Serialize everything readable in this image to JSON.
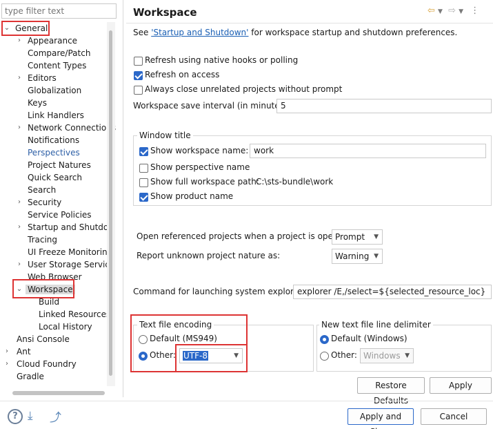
{
  "filter": {
    "placeholder": "type filter text"
  },
  "tree": {
    "general": "General",
    "appearance": "Appearance",
    "compare_patch": "Compare/Patch",
    "content_types": "Content Types",
    "editors": "Editors",
    "globalization": "Globalization",
    "keys": "Keys",
    "link_handlers": "Link Handlers",
    "network_connections": "Network Connections",
    "notifications": "Notifications",
    "perspectives": "Perspectives",
    "project_natures": "Project Natures",
    "quick_search": "Quick Search",
    "search": "Search",
    "security": "Security",
    "service_policies": "Service Policies",
    "startup_shutdown": "Startup and Shutdown",
    "tracing": "Tracing",
    "ui_freeze": "UI Freeze Monitoring",
    "user_storage": "User Storage Service",
    "web_browser": "Web Browser",
    "workspace": "Workspace",
    "build": "Build",
    "linked_resources": "Linked Resources",
    "local_history": "Local History",
    "ansi_console": "Ansi Console",
    "ant": "Ant",
    "cloud_foundry": "Cloud Foundry",
    "gradle": "Gradle"
  },
  "page": {
    "title": "Workspace",
    "see_prefix": "See ",
    "see_link": "'Startup and Shutdown'",
    "see_suffix": " for workspace startup and shutdown preferences.",
    "refresh_native": "Refresh using native hooks or polling",
    "refresh_access": "Refresh on access",
    "always_close": "Always close unrelated projects without prompt",
    "save_interval_label": "Workspace save interval (in minutes):",
    "save_interval_value": "5",
    "window_title_group": "Window title",
    "show_ws_name": "Show workspace name:",
    "ws_name_value": "work",
    "show_perspective": "Show perspective name",
    "show_full_path": "Show full workspace path:",
    "full_path_value": "C:\\sts-bundle\\work",
    "show_product": "Show product name",
    "open_ref_label": "Open referenced projects when a project is opened:",
    "open_ref_value": "Prompt",
    "report_unknown_label": "Report unknown project nature as:",
    "report_unknown_value": "Warning",
    "cmd_label": "Command for launching system explorer:",
    "cmd_value": "explorer /E,/select=${selected_resource_loc}",
    "encoding_group": "Text file encoding",
    "enc_default": "Default (MS949)",
    "enc_other": "Other:",
    "enc_other_value": "UTF-8",
    "delim_group": "New text file line delimiter",
    "delim_default": "Default (Windows)",
    "delim_other": "Other:",
    "delim_other_value": "Windows"
  },
  "buttons": {
    "restore_defaults": "Restore Defaults",
    "apply": "Apply",
    "apply_close": "Apply and Close",
    "cancel": "Cancel"
  },
  "colors": {
    "accent": "#2b68c9",
    "highlight_box": "#dd3333",
    "link": "#1a5fb4"
  }
}
